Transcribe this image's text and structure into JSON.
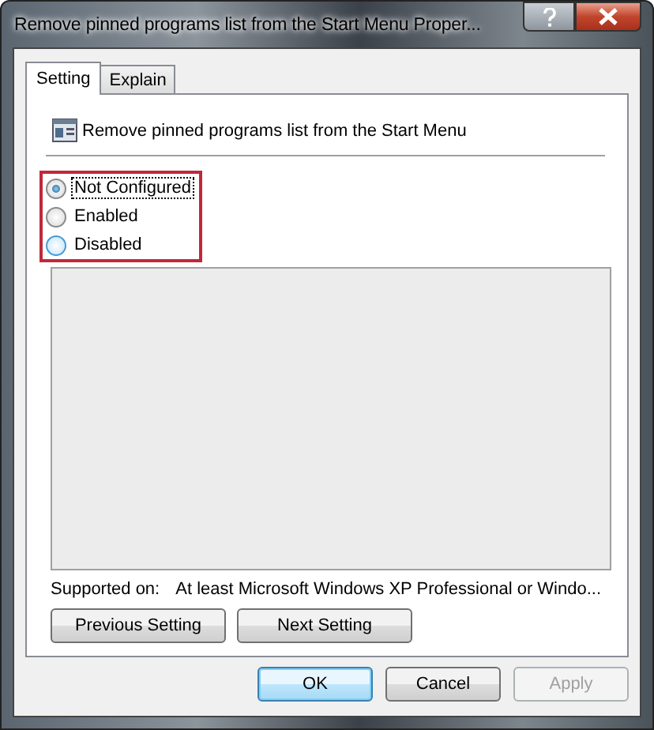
{
  "window": {
    "title": "Remove pinned programs list from the Start Menu Proper..."
  },
  "tabs": [
    {
      "label": "Setting",
      "selected": true
    },
    {
      "label": "Explain",
      "selected": false
    }
  ],
  "policy": {
    "title": "Remove pinned programs list from the Start Menu"
  },
  "options": [
    {
      "label": "Not Configured",
      "selected": true
    },
    {
      "label": "Enabled",
      "selected": false
    },
    {
      "label": "Disabled",
      "selected": false
    }
  ],
  "supported_on": {
    "label": "Supported on:",
    "value": "At least Microsoft Windows XP Professional or Windo..."
  },
  "nav_buttons": [
    "Previous Setting",
    "Next Setting"
  ],
  "dialog_buttons": [
    {
      "label": "OK",
      "default": true,
      "disabled": false
    },
    {
      "label": "Cancel",
      "default": false,
      "disabled": false
    },
    {
      "label": "Apply",
      "default": false,
      "disabled": true
    }
  ]
}
